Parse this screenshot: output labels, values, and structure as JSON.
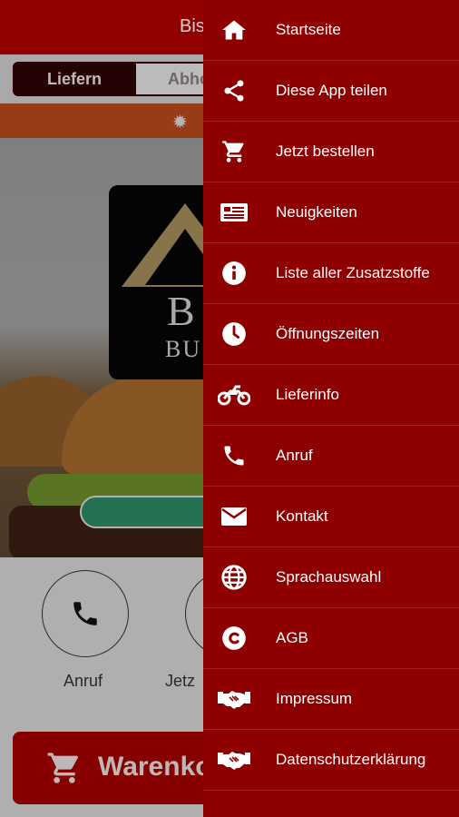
{
  "header": {
    "title_partial": "Bis"
  },
  "order_mode": {
    "delivery_label": "Liefern",
    "pickup_label_partial": "Abho"
  },
  "logo": {
    "line1": "B",
    "line2": "BU"
  },
  "quick_actions": {
    "call_label": "Anruf",
    "order_label_partial": "Jetz"
  },
  "cart": {
    "label_partial": "Warenkorl"
  },
  "colors": {
    "brand_red": "#b30000",
    "drawer_red": "#8e0000",
    "order_bar": "#b84a1f",
    "green_button": "#2b8a64"
  },
  "drawer": {
    "items": [
      {
        "label": "Startseite",
        "icon": "home-icon"
      },
      {
        "label": "Diese App teilen",
        "icon": "share-icon"
      },
      {
        "label": "Jetzt bestellen",
        "icon": "cart-icon"
      },
      {
        "label": "Neuigkeiten",
        "icon": "news-icon"
      },
      {
        "label": "Liste aller Zusatzstoffe",
        "icon": "info-icon"
      },
      {
        "label": "Öffnungszeiten",
        "icon": "clock-icon"
      },
      {
        "label": "Lieferinfo",
        "icon": "motorcycle-icon"
      },
      {
        "label": "Anruf",
        "icon": "phone-icon"
      },
      {
        "label": "Kontakt",
        "icon": "envelope-icon"
      },
      {
        "label": "Sprachauswahl",
        "icon": "globe-icon"
      },
      {
        "label": "AGB",
        "icon": "copyright-icon"
      },
      {
        "label": "Impressum",
        "icon": "handshake-icon"
      },
      {
        "label": "Datenschutzerklärung",
        "icon": "handshake-icon"
      }
    ]
  }
}
